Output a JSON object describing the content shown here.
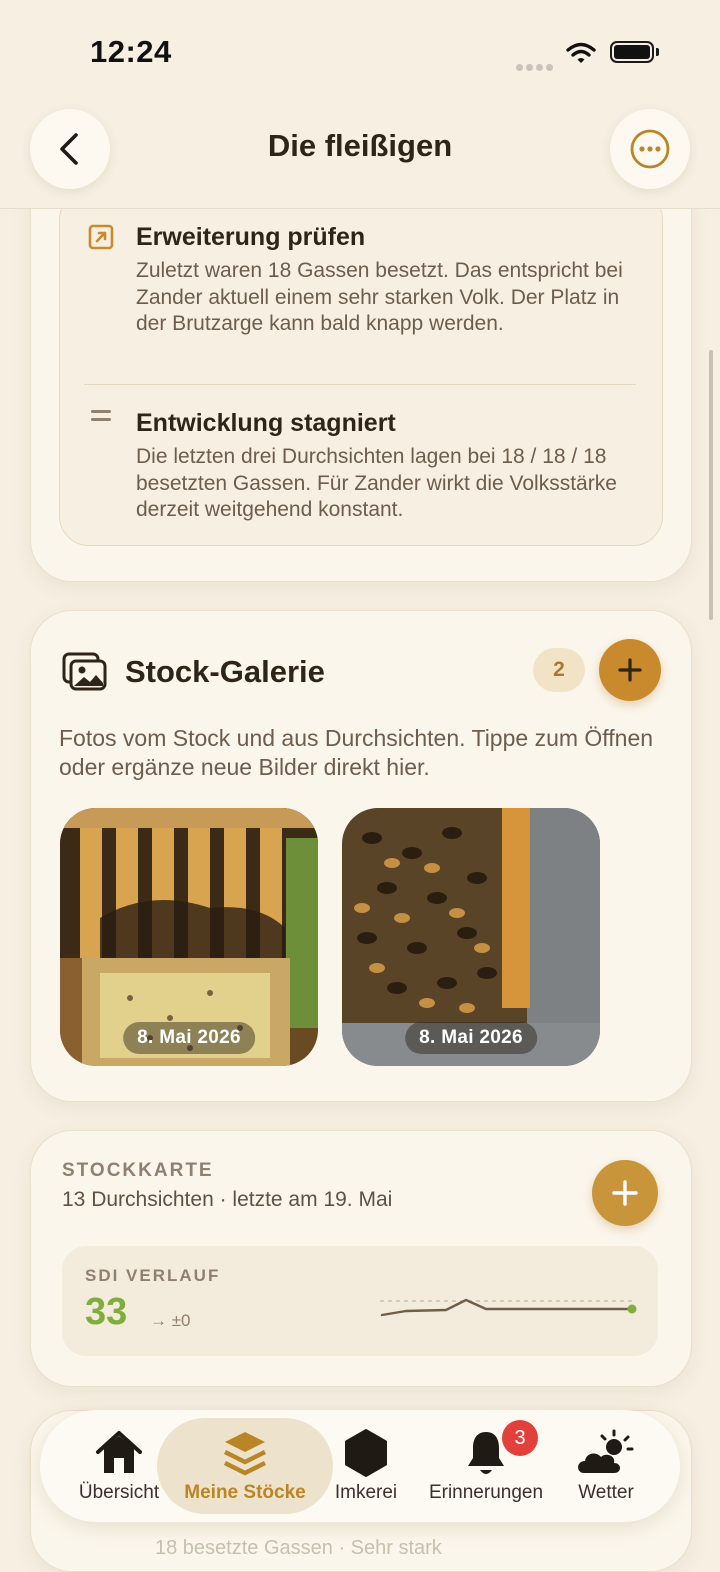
{
  "status_bar": {
    "time": "12:24"
  },
  "header": {
    "title": "Die fleißigen"
  },
  "hints": [
    {
      "title": "Erweiterung prüfen",
      "text": "Zuletzt waren 18 Gassen besetzt. Das entspricht bei Zander aktuell einem sehr starken Volk. Der Platz in der Brutzarge kann bald knapp werden."
    },
    {
      "title": "Entwicklung stagniert",
      "text": "Die letzten drei Durchsichten lagen bei 18 / 18 / 18 besetzten Gassen. Für Zander wirkt die Volksstärke derzeit weitgehend konstant."
    }
  ],
  "gallery": {
    "title": "Stock-Galerie",
    "count": "2",
    "description": "Fotos vom Stock und aus Durchsichten. Tippe zum Öffnen oder ergänze neue Bilder direkt hier.",
    "photos": [
      {
        "date": "8. Mai 2026"
      },
      {
        "date": "8. Mai 2026"
      }
    ]
  },
  "stockkarte": {
    "label": "STOCKKARTE",
    "subtitle": "13 Durchsichten · letzte am 19. Mai",
    "sdi_label": "SDI VERLAUF",
    "sdi_value": "33",
    "sdi_change": "→ ±0"
  },
  "behind_tabbar": {
    "text": "18 besetzte Gassen · Sehr stark"
  },
  "tabs": [
    {
      "label": "Übersicht",
      "icon": "house-icon"
    },
    {
      "label": "Meine Stöcke",
      "icon": "layers-icon",
      "active": true
    },
    {
      "label": "Imkerei",
      "icon": "hexagon-icon"
    },
    {
      "label": "Erinnerungen",
      "icon": "bell-icon",
      "badge": "3"
    },
    {
      "label": "Wetter",
      "icon": "cloud-sun-icon"
    }
  ],
  "colors": {
    "accent": "#c98a2e",
    "sdi_green": "#7fae3c",
    "badge_red": "#e2403b"
  }
}
